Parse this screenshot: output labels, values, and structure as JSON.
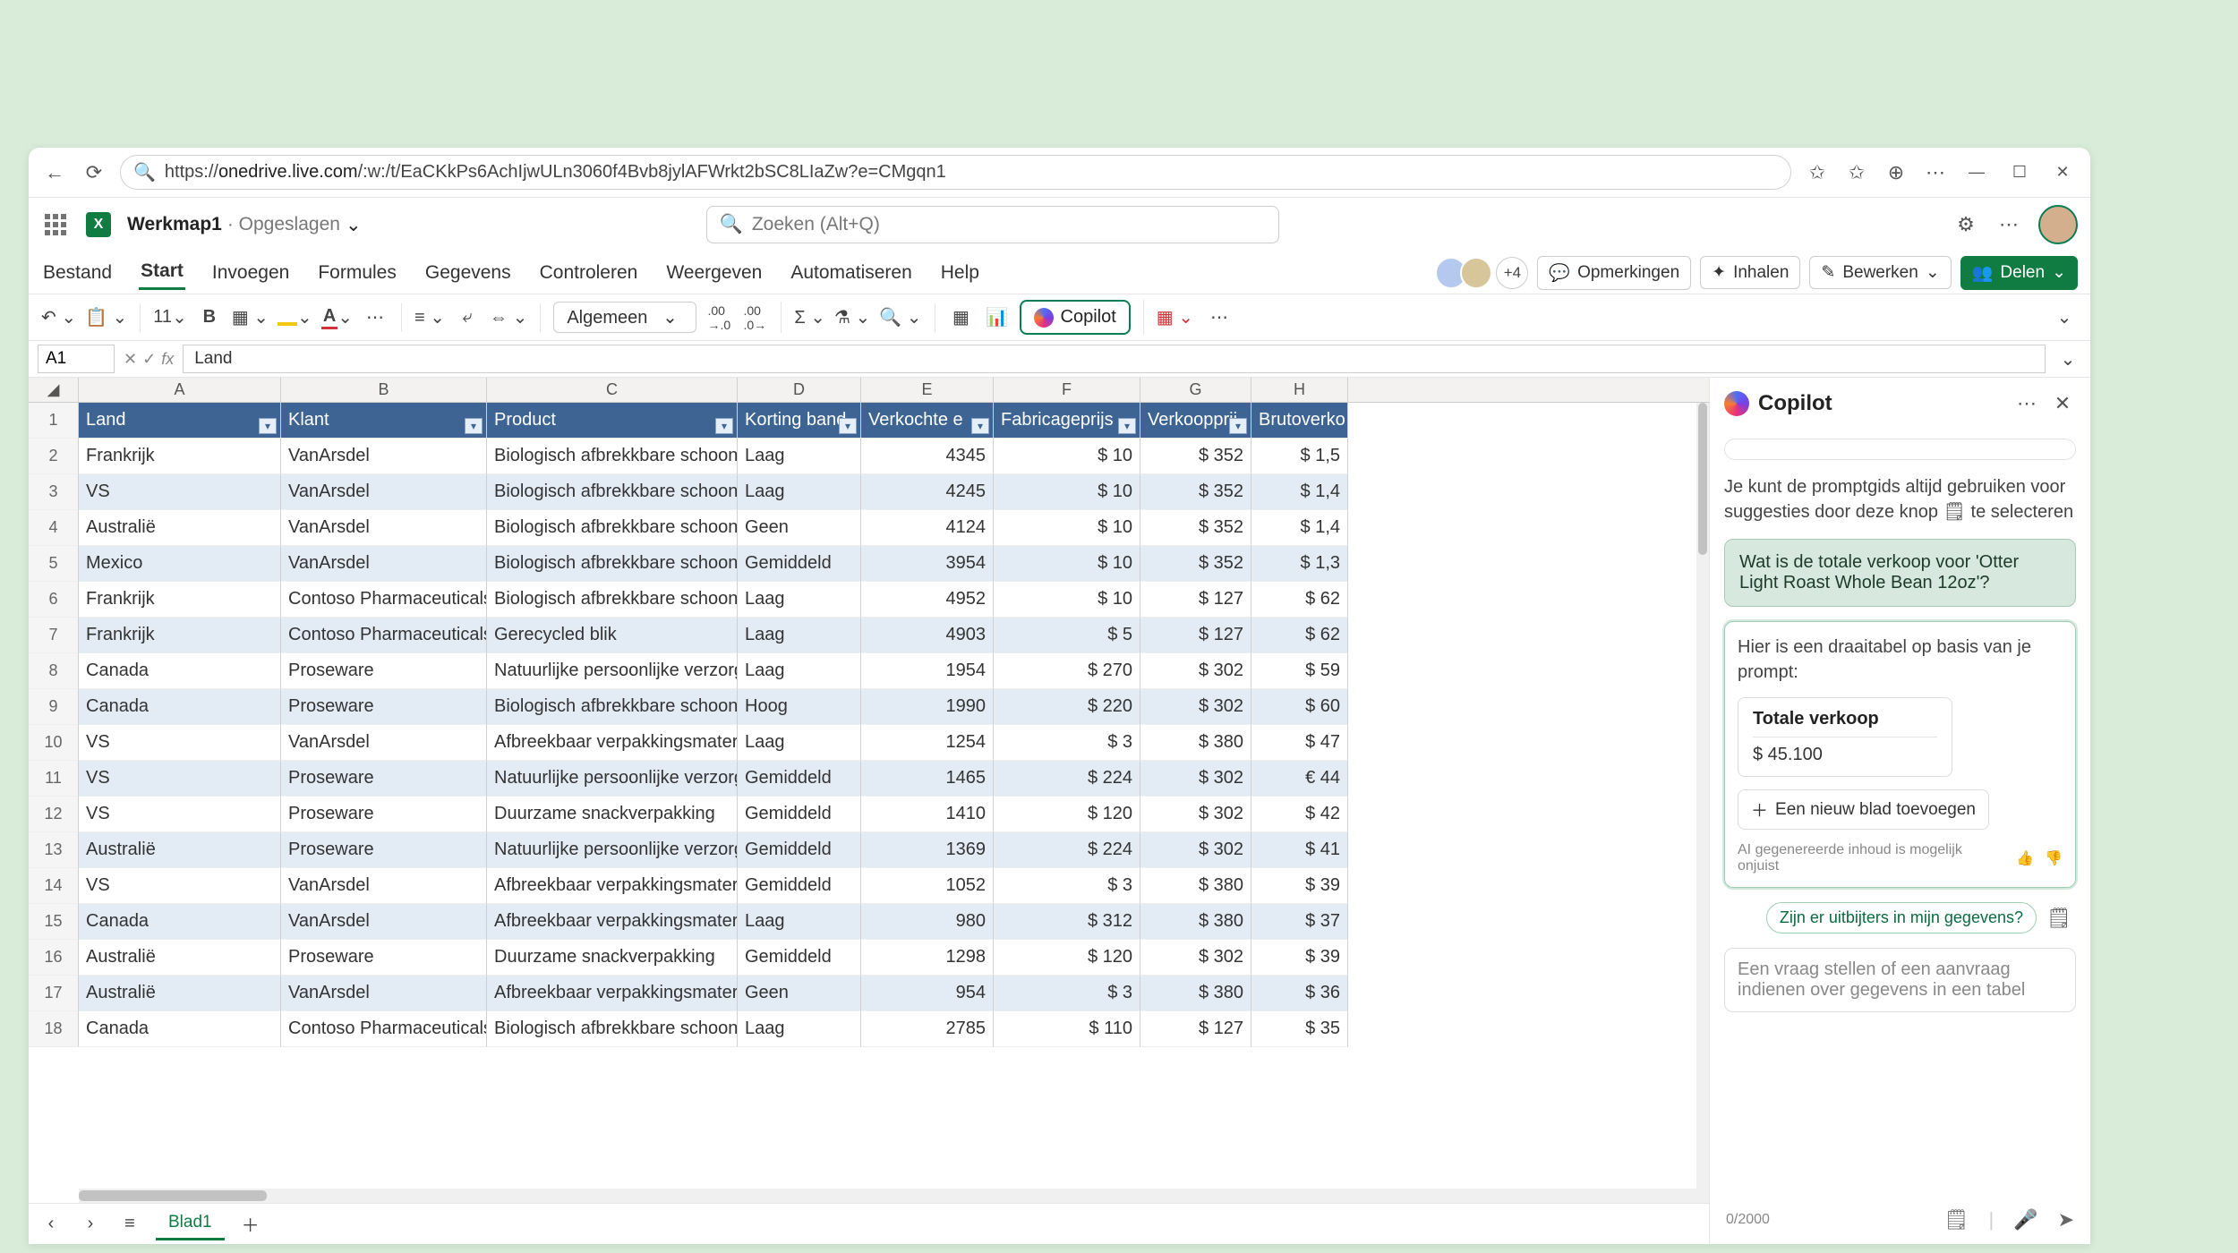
{
  "browser": {
    "url_host": "onedrive.live.com",
    "url_path": "/:w:/t/EaCKkPs6AchIjwULn3060f4Bvb8jylAFWrkt2bSC8LIaZw?e=CMgqn1"
  },
  "workbook": {
    "name": "Werkmap1",
    "saved": "Opgeslagen"
  },
  "search": {
    "placeholder": "Zoeken (Alt+Q)"
  },
  "tabs": {
    "file": "Bestand",
    "home": "Start",
    "insert": "Invoegen",
    "formulas": "Formules",
    "data": "Gegevens",
    "review": "Controleren",
    "view": "Weergeven",
    "automate": "Automatiseren",
    "help": "Help"
  },
  "presence_plus": "+4",
  "action_buttons": {
    "comments": "Opmerkingen",
    "catchup": "Inhalen",
    "editing": "Bewerken",
    "share": "Delen"
  },
  "toolbar": {
    "font_size": "11",
    "number_format": "Algemeen",
    "copilot": "Copilot"
  },
  "namebox": "A1",
  "formula_value": "Land",
  "columns": [
    "A",
    "B",
    "C",
    "D",
    "E",
    "F",
    "G",
    "H"
  ],
  "header_row": {
    "A": "Land",
    "B": "Klant",
    "C": "Product",
    "D": "Korting band",
    "E": "Verkochte e",
    "F": "Fabricageprijs",
    "G": "Verkoopprij",
    "H": "Brutoverko"
  },
  "rows": [
    {
      "n": 2,
      "band": 0,
      "A": "Frankrijk",
      "B": "VanArsdel",
      "C": "Biologisch afbrekkbare schoonma",
      "D": "Laag",
      "E": "4345",
      "F": "$ 10",
      "G": "$ 352",
      "H": "$ 1,5"
    },
    {
      "n": 3,
      "band": 1,
      "A": "VS",
      "B": "VanArsdel",
      "C": "Biologisch afbrekkbare schoonma",
      "D": "Laag",
      "E": "4245",
      "F": "$ 10",
      "G": "$ 352",
      "H": "$ 1,4"
    },
    {
      "n": 4,
      "band": 0,
      "A": "Australië",
      "B": "VanArsdel",
      "C": "Biologisch afbrekkbare schoonma",
      "D": "Geen",
      "E": "4124",
      "F": "$ 10",
      "G": "$ 352",
      "H": "$ 1,4"
    },
    {
      "n": 5,
      "band": 1,
      "A": "Mexico",
      "B": "VanArsdel",
      "C": "Biologisch afbrekkbare schoonma",
      "D": "Gemiddeld",
      "E": "3954",
      "F": "$ 10",
      "G": "$ 352",
      "H": "$ 1,3"
    },
    {
      "n": 6,
      "band": 0,
      "A": "Frankrijk",
      "B": "Contoso Pharmaceuticals",
      "C": "Biologisch afbrekkbare schoonma",
      "D": "Laag",
      "E": "4952",
      "F": "$ 10",
      "G": "$ 127",
      "H": "$ 62"
    },
    {
      "n": 7,
      "band": 1,
      "A": "Frankrijk",
      "B": "Contoso Pharmaceuticals",
      "C": "Gerecycled blik",
      "D": "Laag",
      "E": "4903",
      "F": "$ 5",
      "G": "$ 127",
      "H": "$ 62"
    },
    {
      "n": 8,
      "band": 0,
      "A": "Canada",
      "B": "Proseware",
      "C": "Natuurlijke persoonlijke verzorging",
      "D": "Laag",
      "E": "1954",
      "F": "$ 270",
      "G": "$ 302",
      "H": "$ 59"
    },
    {
      "n": 9,
      "band": 1,
      "A": "Canada",
      "B": "Proseware",
      "C": "Biologisch afbrekkbare schoonma",
      "D": "Hoog",
      "E": "1990",
      "F": "$ 220",
      "G": "$ 302",
      "H": "$ 60"
    },
    {
      "n": 10,
      "band": 0,
      "A": "VS",
      "B": "VanArsdel",
      "C": "Afbreekbaar verpakkingsmateriaal",
      "D": "Laag",
      "E": "1254",
      "F": "$ 3",
      "G": "$ 380",
      "H": "$ 47"
    },
    {
      "n": 11,
      "band": 1,
      "A": "VS",
      "B": "Proseware",
      "C": "Natuurlijke persoonlijke verzorging",
      "D": "Gemiddeld",
      "E": "1465",
      "F": "$ 224",
      "G": "$ 302",
      "H": "€ 44"
    },
    {
      "n": 12,
      "band": 0,
      "A": "VS",
      "B": "Proseware",
      "C": "Duurzame snackverpakking",
      "D": "Gemiddeld",
      "E": "1410",
      "F": "$ 120",
      "G": "$ 302",
      "H": "$ 42"
    },
    {
      "n": 13,
      "band": 1,
      "A": "Australië",
      "B": "Proseware",
      "C": "Natuurlijke persoonlijke verzorging",
      "D": "Gemiddeld",
      "E": "1369",
      "F": "$ 224",
      "G": "$ 302",
      "H": "$ 41"
    },
    {
      "n": 14,
      "band": 0,
      "A": "VS",
      "B": "VanArsdel",
      "C": "Afbreekbaar verpakkingsmateriaal",
      "D": "Gemiddeld",
      "E": "1052",
      "F": "$ 3",
      "G": "$ 380",
      "H": "$ 39"
    },
    {
      "n": 15,
      "band": 1,
      "A": "Canada",
      "B": "VanArsdel",
      "C": "Afbreekbaar verpakkingsmateriaal",
      "D": "Laag",
      "E": "980",
      "F": "$ 312",
      "G": "$ 380",
      "H": "$ 37"
    },
    {
      "n": 16,
      "band": 0,
      "A": "Australië",
      "B": "Proseware",
      "C": "Duurzame snackverpakking",
      "D": "Gemiddeld",
      "E": "1298",
      "F": "$ 120",
      "G": "$ 302",
      "H": "$ 39"
    },
    {
      "n": 17,
      "band": 1,
      "A": "Australië",
      "B": "VanArsdel",
      "C": "Afbreekbaar verpakkingsmateriaal",
      "D": "Geen",
      "E": "954",
      "F": "$ 3",
      "G": "$ 380",
      "H": "$ 36"
    },
    {
      "n": 18,
      "band": 0,
      "A": "Canada",
      "B": "Contoso Pharmaceuticals",
      "C": "Biologisch afbrekkbare schoonma",
      "D": "Laag",
      "E": "2785",
      "F": "$ 110",
      "G": "$ 127",
      "H": "$ 35"
    }
  ],
  "sheet": {
    "name": "Blad1"
  },
  "copilot": {
    "title": "Copilot",
    "tip": "Je kunt de promptgids altijd gebruiken voor suggesties door deze knop 🗒 te selecteren",
    "user_msg": "Wat is de totale verkoop voor 'Otter Light Roast Whole Bean 12oz'?",
    "response_intro": "Hier is een draaitabel op basis van je prompt:",
    "pivot_title": "Totale verkoop",
    "pivot_value": "$ 45.100",
    "add_sheet": "Een nieuw blad toevoegen",
    "disclaimer": "AI gegenereerde inhoud is mogelijk onjuist",
    "suggestion": "Zijn er uitbijters in mijn gegevens?",
    "input_placeholder": "Een vraag stellen of een aanvraag indienen over gegevens in een tabel",
    "counter": "0/2000"
  }
}
